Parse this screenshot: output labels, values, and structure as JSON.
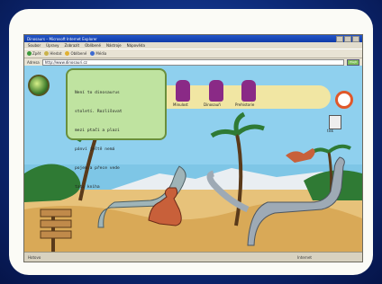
{
  "window": {
    "title": "Dinosaurs – Microsoft Internet Explorer",
    "menu": [
      "Soubor",
      "Úpravy",
      "Zobrazit",
      "Oblíbené",
      "Nástroje",
      "Nápověda"
    ],
    "toolbar": [
      "Zpět",
      "Hledat",
      "Oblíbené",
      "Média"
    ],
    "address_label": "Adresa",
    "address_value": "http://www.dinosauri.cz",
    "go_label": "Přejít",
    "status_left": "Hotovo",
    "status_zone": "Internet"
  },
  "page": {
    "note_lines": [
      "Není to dinosaurus",
      "století. Rozlišovat",
      "mezi ptačí a plazi",
      "pánví ještě nemá",
      "pojem a přece vede",
      "tato kniha"
    ],
    "tabs": [
      "Minulost",
      "Dinosauři",
      "Prehistorie"
    ],
    "doc_label": "tisk"
  }
}
